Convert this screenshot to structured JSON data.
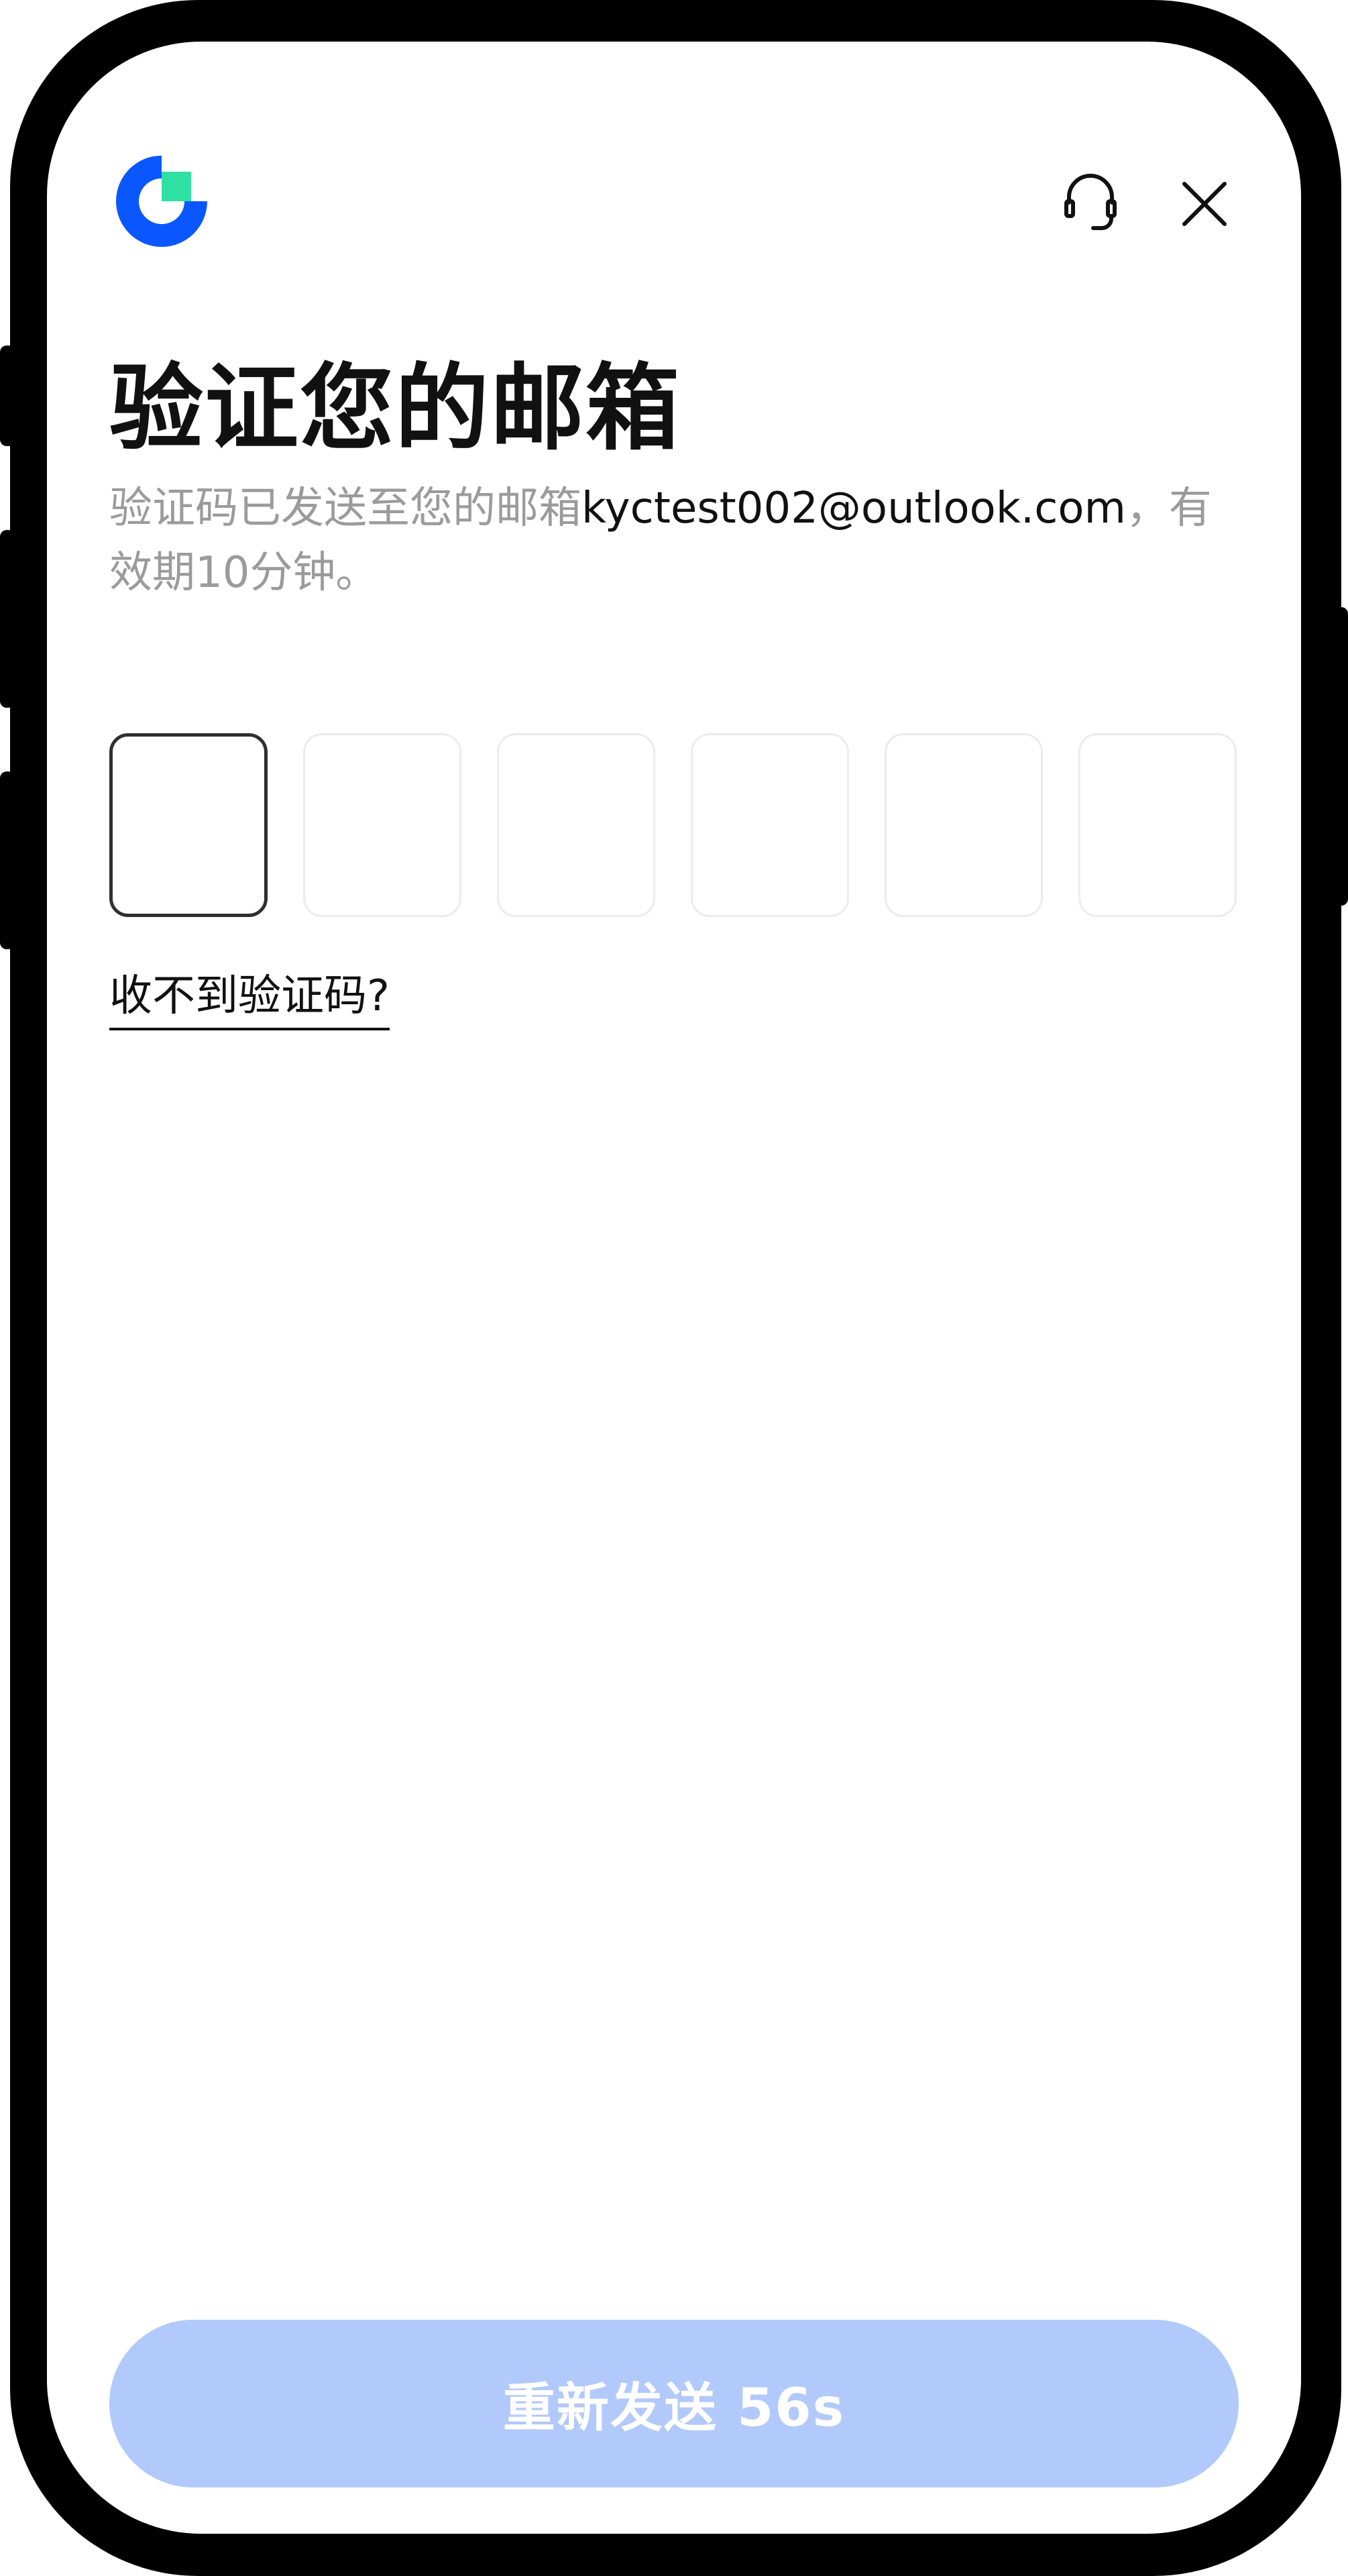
{
  "header": {
    "logo_icon": "brand-logo-icon",
    "support_icon": "headset-icon",
    "close_icon": "close-icon"
  },
  "page": {
    "title": "验证您的邮箱",
    "subtitle_prefix": "验证码已发送至您的邮箱",
    "email": "kyctest002@outlook.com",
    "subtitle_suffix": "，有效期10分钟。"
  },
  "code_input": {
    "length": 6,
    "values": [
      "",
      "",
      "",
      "",
      "",
      ""
    ],
    "active_index": 0
  },
  "help": {
    "link_label": "收不到验证码?"
  },
  "footer": {
    "resend_label": "重新发送 56s"
  },
  "colors": {
    "brand_blue": "#0b57ff",
    "brand_green": "#2ee0a1",
    "button_disabled": "#b2c9fb",
    "subtitle_gray": "#9b9b9b"
  }
}
